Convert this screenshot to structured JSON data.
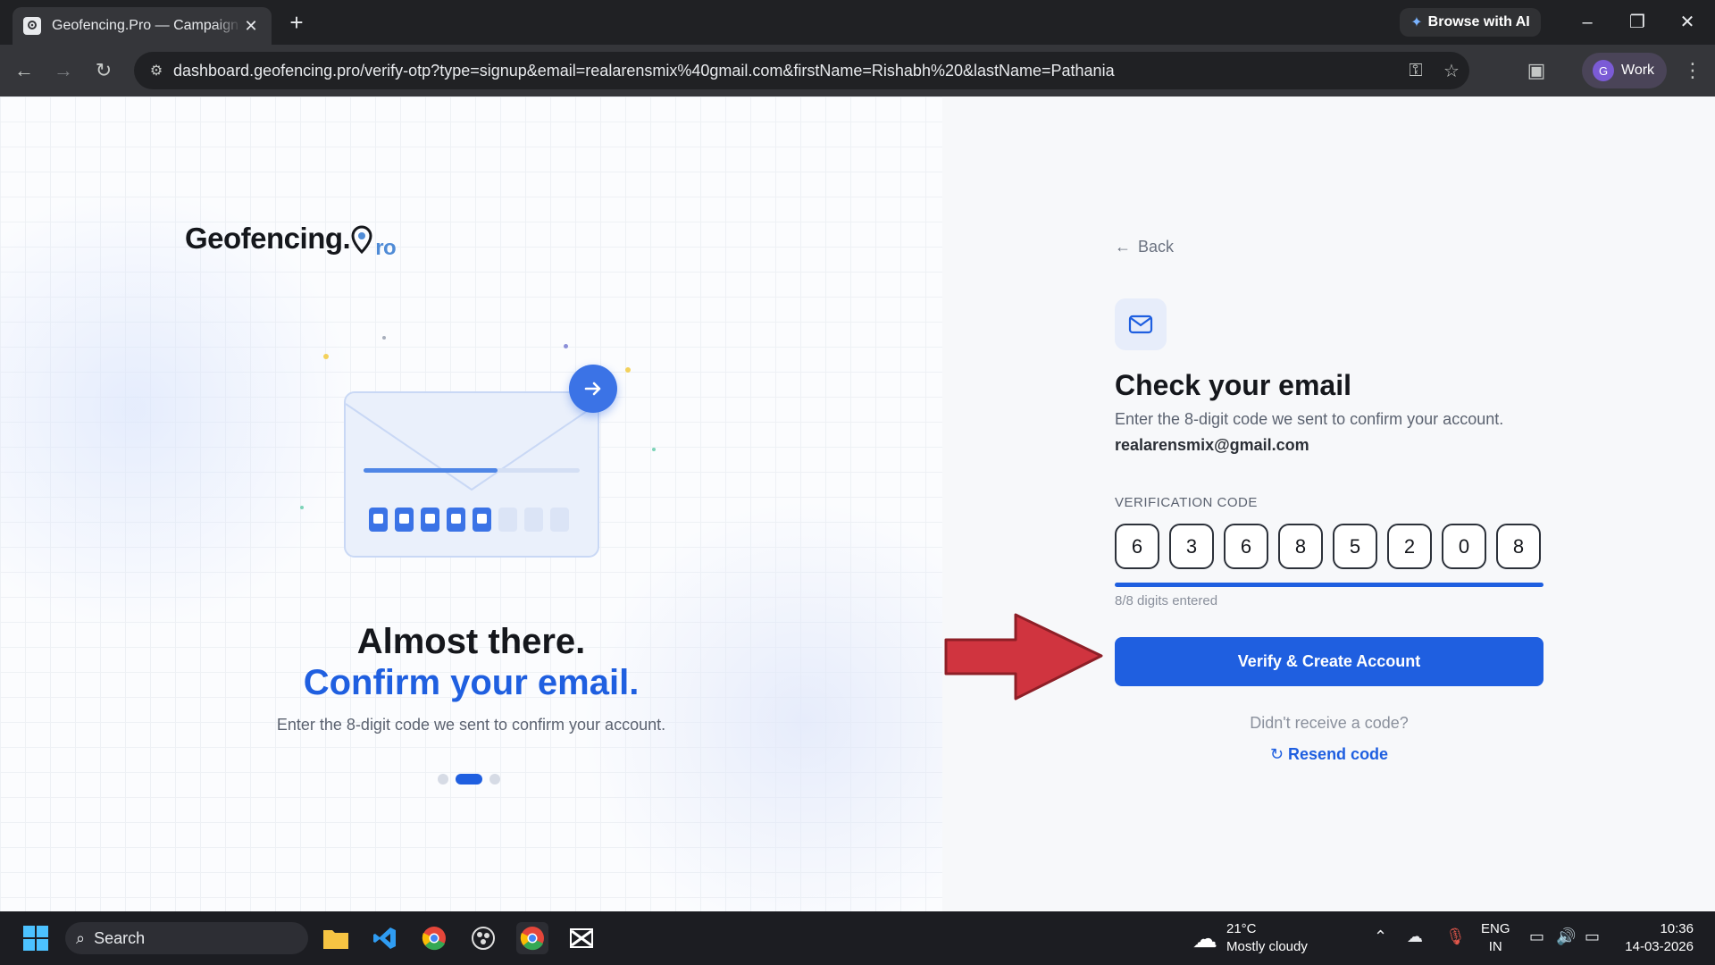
{
  "browser": {
    "tab_title": "Geofencing.Pro — Campaign M",
    "url": "dashboard.geofencing.pro/verify-otp?type=signup&email=realarensmix%40gmail.com&firstName=Rishabh%20&lastName=Pathania",
    "browse_ai_label": "Browse with AI",
    "profile_initial": "G",
    "profile_label": "Work"
  },
  "left_panel": {
    "logo_text": "Geofencing.",
    "logo_suffix": "ro",
    "hero_line1": "Almost there.",
    "hero_line2": "Confirm your email.",
    "hero_sub": "Enter the 8-digit code we sent to confirm your account.",
    "pager": {
      "count": 3,
      "active": 2
    }
  },
  "right_panel": {
    "back_label": "Back",
    "title": "Check your email",
    "subtitle": "Enter the 8-digit code we sent to confirm your account.",
    "email": "realarensmix@gmail.com",
    "code_label": "VERIFICATION CODE",
    "code_digits": [
      "6",
      "3",
      "6",
      "8",
      "5",
      "2",
      "0",
      "8"
    ],
    "digits_status": "8/8 digits entered",
    "progress": 1.0,
    "verify_button": "Verify & Create Account",
    "no_code_text": "Didn't receive a code?",
    "resend_label": "Resend code"
  },
  "taskbar": {
    "search_label": "Search",
    "temperature": "21°C",
    "weather": "Mostly cloudy",
    "lang_top": "ENG",
    "lang_bottom": "IN",
    "time": "10:36",
    "date": "14-03-2026"
  },
  "colors": {
    "accent": "#1f5fe0",
    "annotation_arrow": "#d0343f"
  }
}
